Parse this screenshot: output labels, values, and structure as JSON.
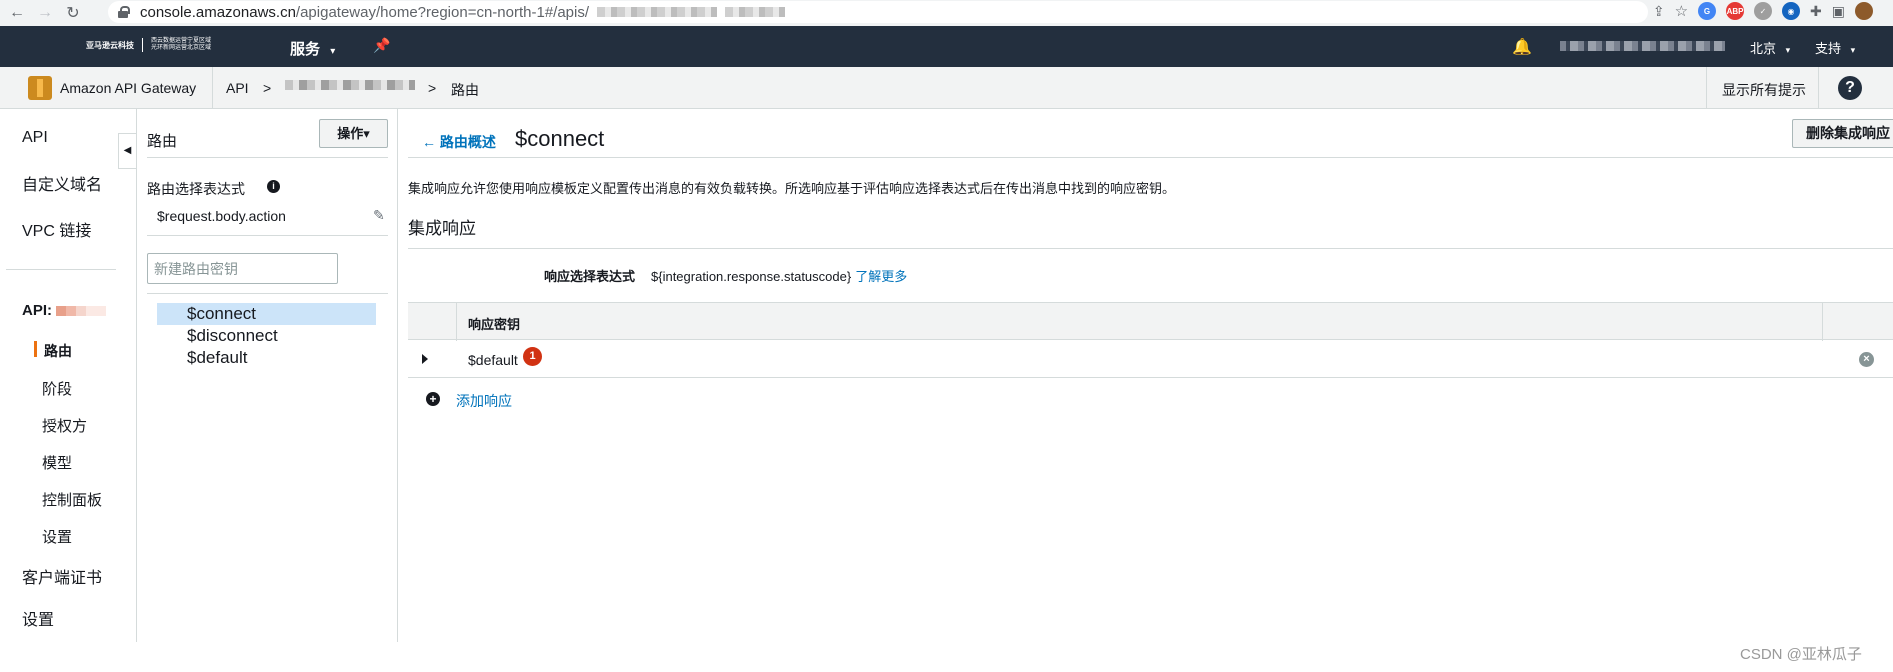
{
  "browser": {
    "url_host": "console.amazonaws.cn",
    "url_path": "/apigateway/home?region=cn-north-1#/apis/"
  },
  "topnav": {
    "logo_brand": "亚马逊云科技",
    "logo_sub_1": "西云数据运营宁夏区域",
    "logo_sub_2": "光环新网运营北京区域",
    "services_label": "服务",
    "region_label": "北京",
    "support_label": "支持"
  },
  "svcbar": {
    "service_name": "Amazon API Gateway",
    "crumb_api": "API",
    "crumb_sep1": ">",
    "crumb_sep2": ">",
    "crumb_routes": "路由",
    "hints_label": "显示所有提示",
    "help_icon": "?"
  },
  "leftnav": {
    "items": {
      "api": "API",
      "custom_domains": "自定义域名",
      "vpc_links": "VPC 链接",
      "api_label": "API:",
      "routes": "路由",
      "stages": "阶段",
      "authorizers": "授权方",
      "models": "模型",
      "dashboard": "控制面板",
      "settings_sub": "设置",
      "client_certs": "客户端证书",
      "settings": "设置"
    }
  },
  "routes_panel": {
    "title": "路由",
    "ops_button": "操作▾",
    "expr_label": "路由选择表达式",
    "expr_value": "$request.body.action",
    "new_route_placeholder": "新建路由密钥",
    "routes": [
      "$connect",
      "$disconnect",
      "$default"
    ]
  },
  "main": {
    "back_link": "← 路由概述",
    "title": "$connect",
    "delete_button": "删除集成响应",
    "description": "集成响应允许您使用响应模板定义配置传出消息的有效负载转换。所选响应基于评估响应选择表达式后在传出消息中找到的响应密钥。",
    "section_title": "集成响应",
    "selection_label": "响应选择表达式",
    "selection_value": "${integration.response.statuscode}",
    "learn_more": "了解更多",
    "table_header": "响应密钥",
    "rows": [
      {
        "key": "$default",
        "badge": "1"
      }
    ],
    "add_response": "添加响应"
  },
  "watermark": "CSDN @亚林瓜子"
}
